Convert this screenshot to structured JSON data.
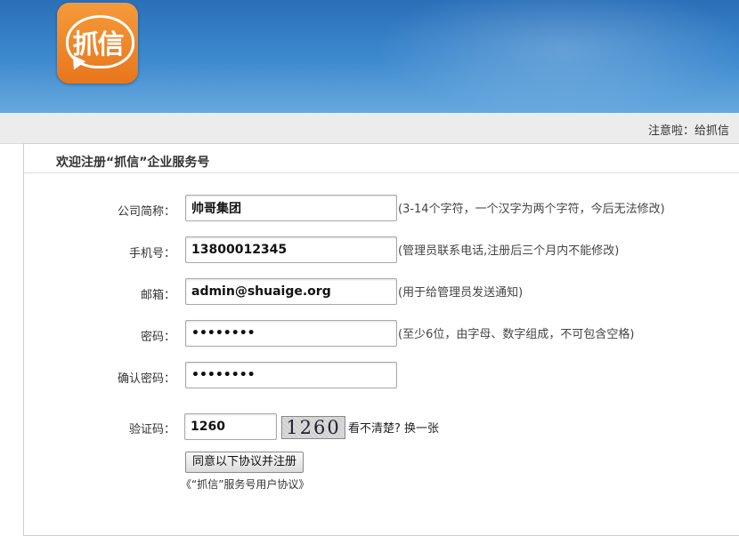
{
  "header": {
    "logo_text": "抓信"
  },
  "notice": {
    "text": "注意啦：给抓信"
  },
  "form": {
    "title": "欢迎注册“抓信”企业服务号",
    "fields": [
      {
        "label": "公司简称：",
        "value": "帅哥集团",
        "hint": "(3-14个字符，一个汉字为两个字符，今后无法修改)"
      },
      {
        "label": "手机号：",
        "value": "13800012345",
        "hint": "(管理员联系电话,注册后三个月内不能修改)"
      },
      {
        "label": "邮箱：",
        "value": "admin@shuaige.org",
        "hint": "(用于给管理员发送通知)"
      },
      {
        "label": "密码：",
        "value": "••••••••",
        "hint": "(至少6位，由字母、数字组成，不可包含空格)"
      },
      {
        "label": "确认密码：",
        "value": "••••••••",
        "hint": ""
      }
    ],
    "captcha": {
      "label": "验证码：",
      "value": "1260",
      "image_text": "1260",
      "refresh_text": "看不清楚? 换一张"
    },
    "submit_label": "同意以下协议并注册",
    "agreement_link": "《“抓信”服务号用户协议》"
  }
}
